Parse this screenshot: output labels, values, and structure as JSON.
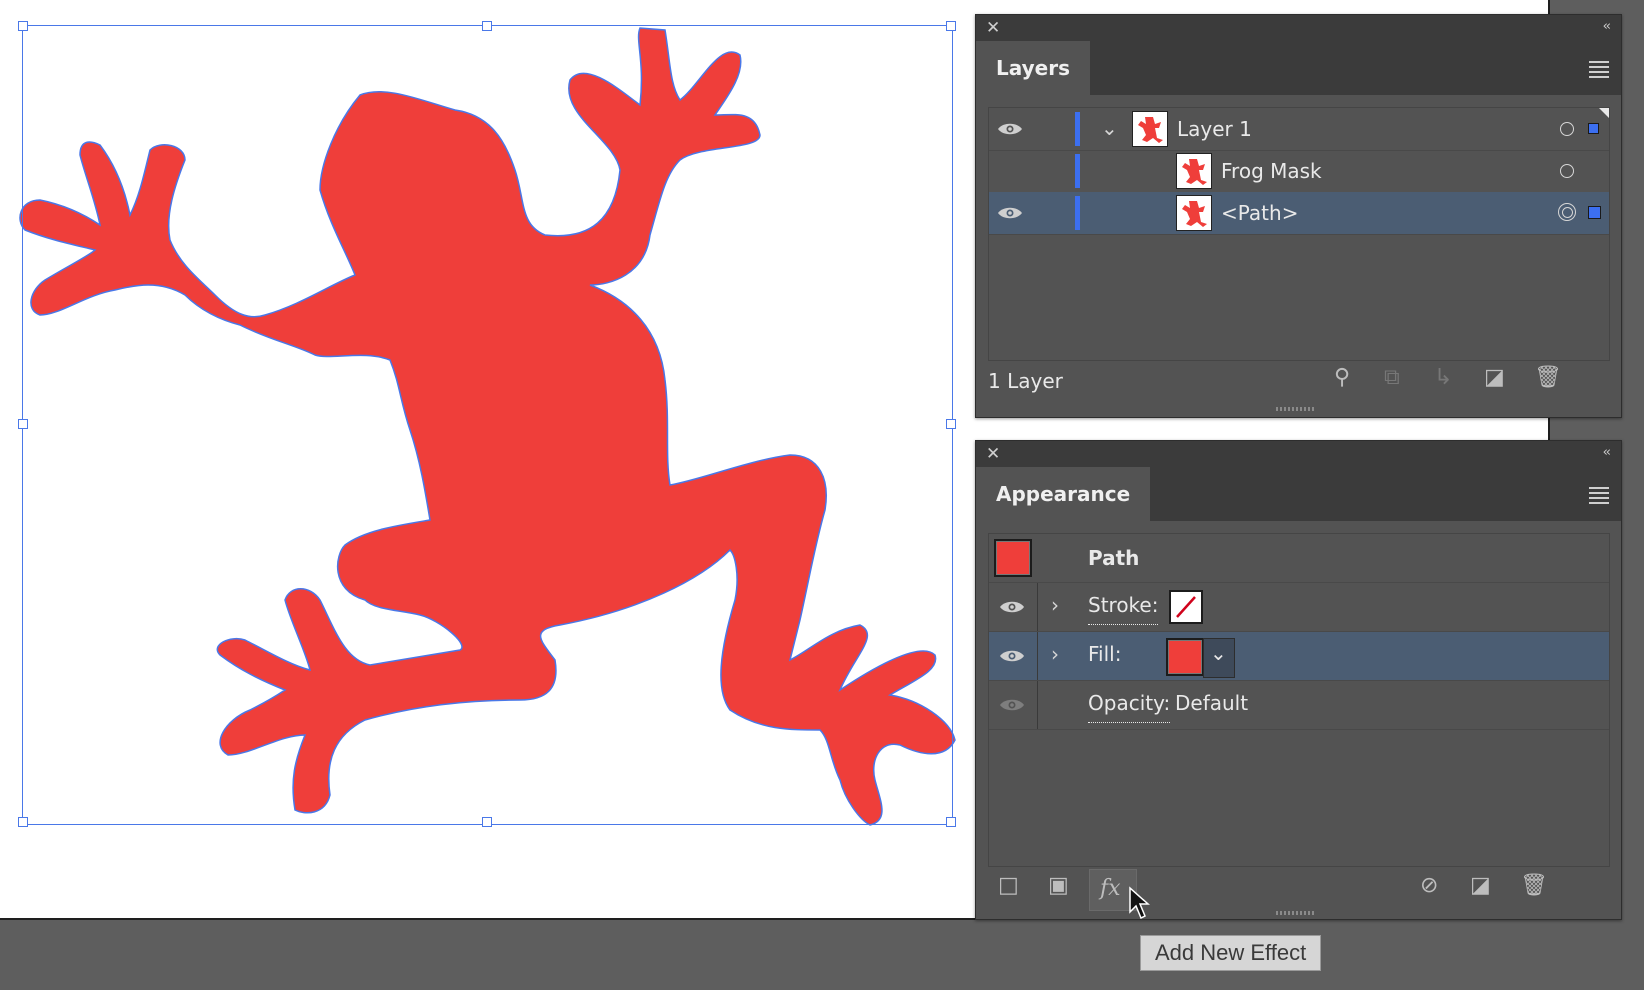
{
  "layers_panel": {
    "tab_label": "Layers",
    "rows": [
      {
        "name": "Layer 1"
      },
      {
        "name": "Frog Mask"
      },
      {
        "name": "<Path>"
      }
    ],
    "footer_count": "1 Layer"
  },
  "appearance_panel": {
    "tab_label": "Appearance",
    "object_label": "Path",
    "stroke_label": "Stroke:",
    "fill_label": "Fill:",
    "opacity_label": "Opacity:",
    "opacity_value": "Default",
    "fill_color": "#ef3e3a"
  },
  "tooltip": {
    "text": "Add New Effect"
  },
  "colors": {
    "selection": "#4a78e8",
    "layer_color": "#3c6ff0",
    "frog_fill": "#ef3e3a",
    "panel_bg": "#535353",
    "selected_row": "#4b5d73"
  },
  "icons": {
    "close": "close-icon",
    "collapse": "double-chevron-left-icon",
    "menu": "hamburger-menu-icon",
    "visibility": "eye-icon",
    "expand": "chevron-down-icon",
    "search": "search-icon",
    "collect": "collect-icon",
    "move_to_layer": "move-to-layer-icon",
    "new_layer": "new-layer-icon",
    "delete": "trash-icon",
    "add_stroke": "add-stroke-icon",
    "add_fill": "add-fill-icon",
    "fx": "fx-icon",
    "clear": "clear-icon",
    "duplicate": "duplicate-icon"
  }
}
